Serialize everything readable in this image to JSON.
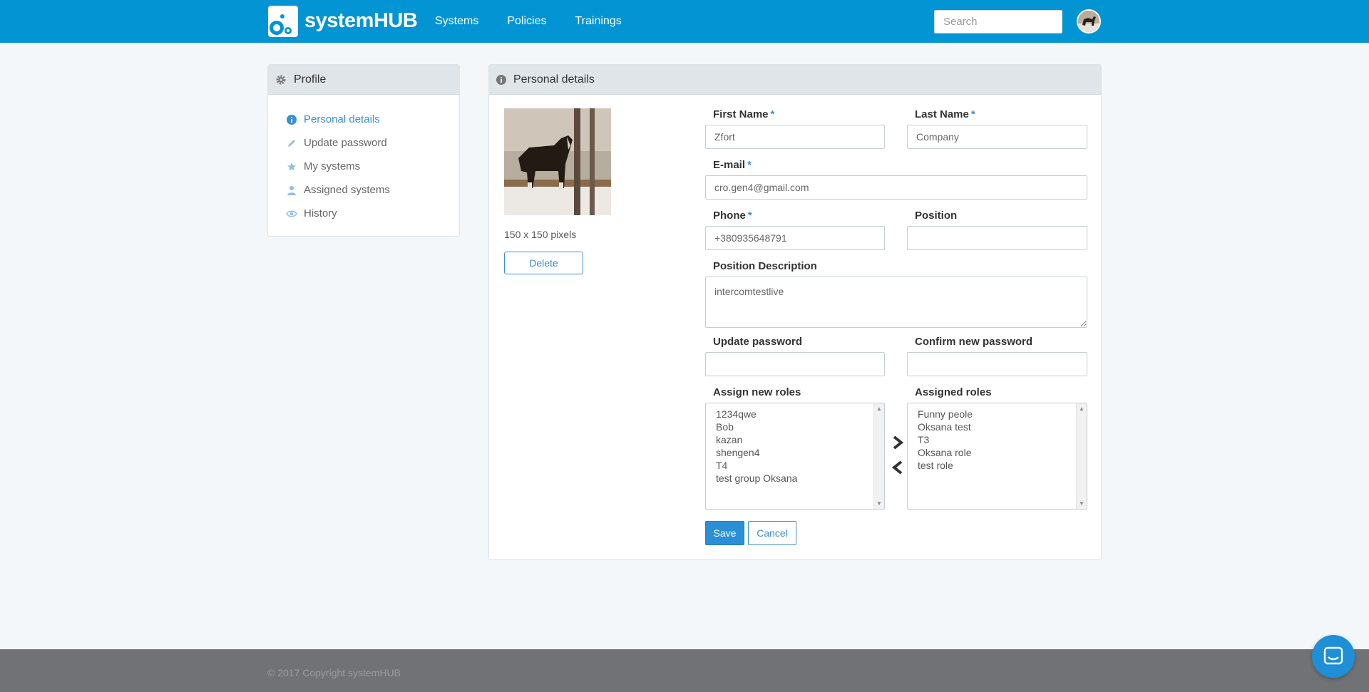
{
  "header": {
    "brand": "systemHUB",
    "nav": [
      "Systems",
      "Policies",
      "Trainings"
    ],
    "search_placeholder": "Search"
  },
  "sidebar": {
    "title": "Profile",
    "items": [
      {
        "label": "Personal details",
        "icon": "info-icon",
        "active": true
      },
      {
        "label": "Update password",
        "icon": "pencil-icon"
      },
      {
        "label": "My systems",
        "icon": "star-icon"
      },
      {
        "label": "Assigned systems",
        "icon": "user-icon"
      },
      {
        "label": "History",
        "icon": "eye-icon"
      }
    ]
  },
  "details": {
    "title": "Personal details",
    "photo_caption": "150 x 150 pixels",
    "delete_label": "Delete",
    "first_name": {
      "label": "First Name",
      "value": "Zfort"
    },
    "last_name": {
      "label": "Last Name",
      "value": "Company"
    },
    "email": {
      "label": "E-mail",
      "value": "cro.gen4@gmail.com"
    },
    "phone": {
      "label": "Phone",
      "value": "+380935648791"
    },
    "position": {
      "label": "Position",
      "value": ""
    },
    "position_description": {
      "label": "Position Description",
      "value": "intercomtestlive"
    },
    "update_password": {
      "label": "Update password"
    },
    "confirm_password": {
      "label": "Confirm new password"
    },
    "assign_roles": {
      "label": "Assign new roles",
      "options": [
        "1234qwe",
        "Bob",
        "kazan",
        "shengen4",
        "T4",
        "test group Oksana"
      ]
    },
    "assigned_roles": {
      "label": "Assigned roles",
      "options": [
        "Funny peole",
        "Oksana test",
        "T3",
        "Oksana role",
        "test role"
      ]
    },
    "save_label": "Save",
    "cancel_label": "Cancel"
  },
  "footer": {
    "copyright": "© 2017 Copyright systemHUB"
  },
  "colors": {
    "brand": "#0394d3",
    "accent": "#3a8fd0",
    "footer": "#707275"
  }
}
